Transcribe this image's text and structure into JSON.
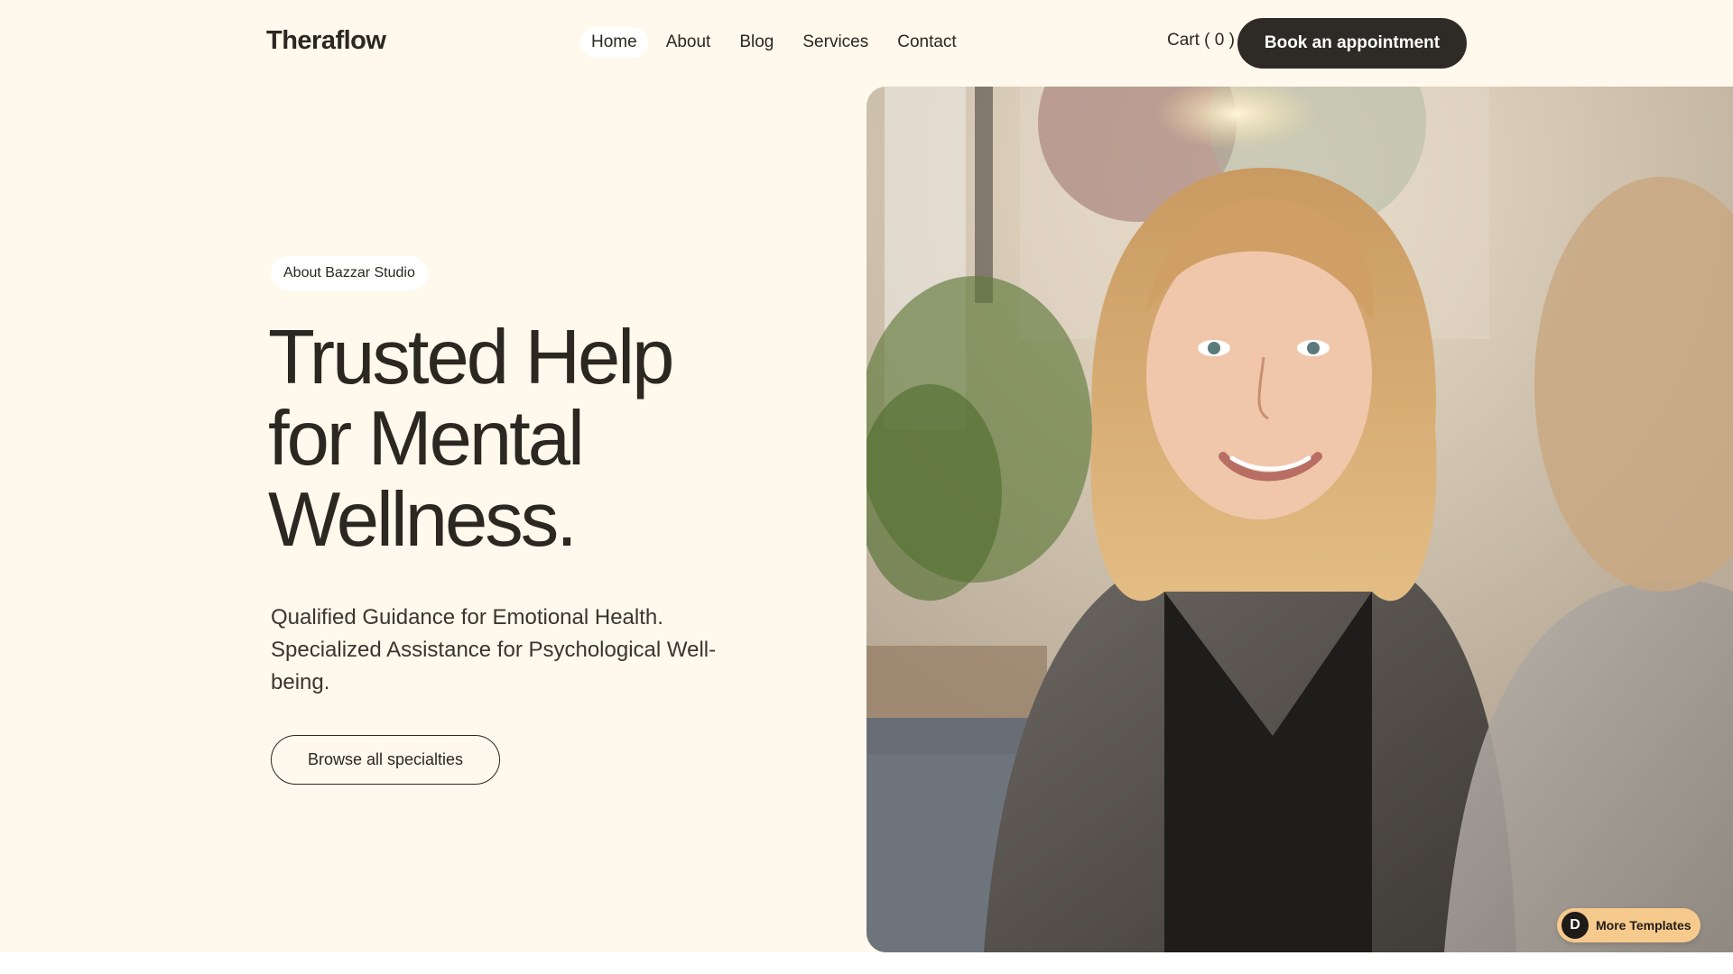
{
  "brand": {
    "name": "Theraflow"
  },
  "nav": {
    "items": [
      {
        "label": "Home",
        "active": true
      },
      {
        "label": "About",
        "active": false
      },
      {
        "label": "Blog",
        "active": false
      },
      {
        "label": "Services",
        "active": false
      },
      {
        "label": "Contact",
        "active": false
      }
    ]
  },
  "header": {
    "cart_label": "Cart ( 0 )",
    "book_button": "Book an appointment"
  },
  "hero": {
    "eyebrow": "About Bazzar Studio",
    "headline": "Trusted Help for Mental Wellness.",
    "subtext": "Qualified Guidance for Emotional Health. Specialized Assistance for Psychological Well-being.",
    "cta_label": "Browse all specialties",
    "image_icon": "photo-of-smiling-woman-in-therapy-session"
  },
  "badge": {
    "icon": "D",
    "label": "More Templates"
  },
  "colors": {
    "background": "#fef9ec",
    "text": "#2b2721",
    "button_dark": "#2e2a25",
    "badge": "#f6c98c"
  }
}
